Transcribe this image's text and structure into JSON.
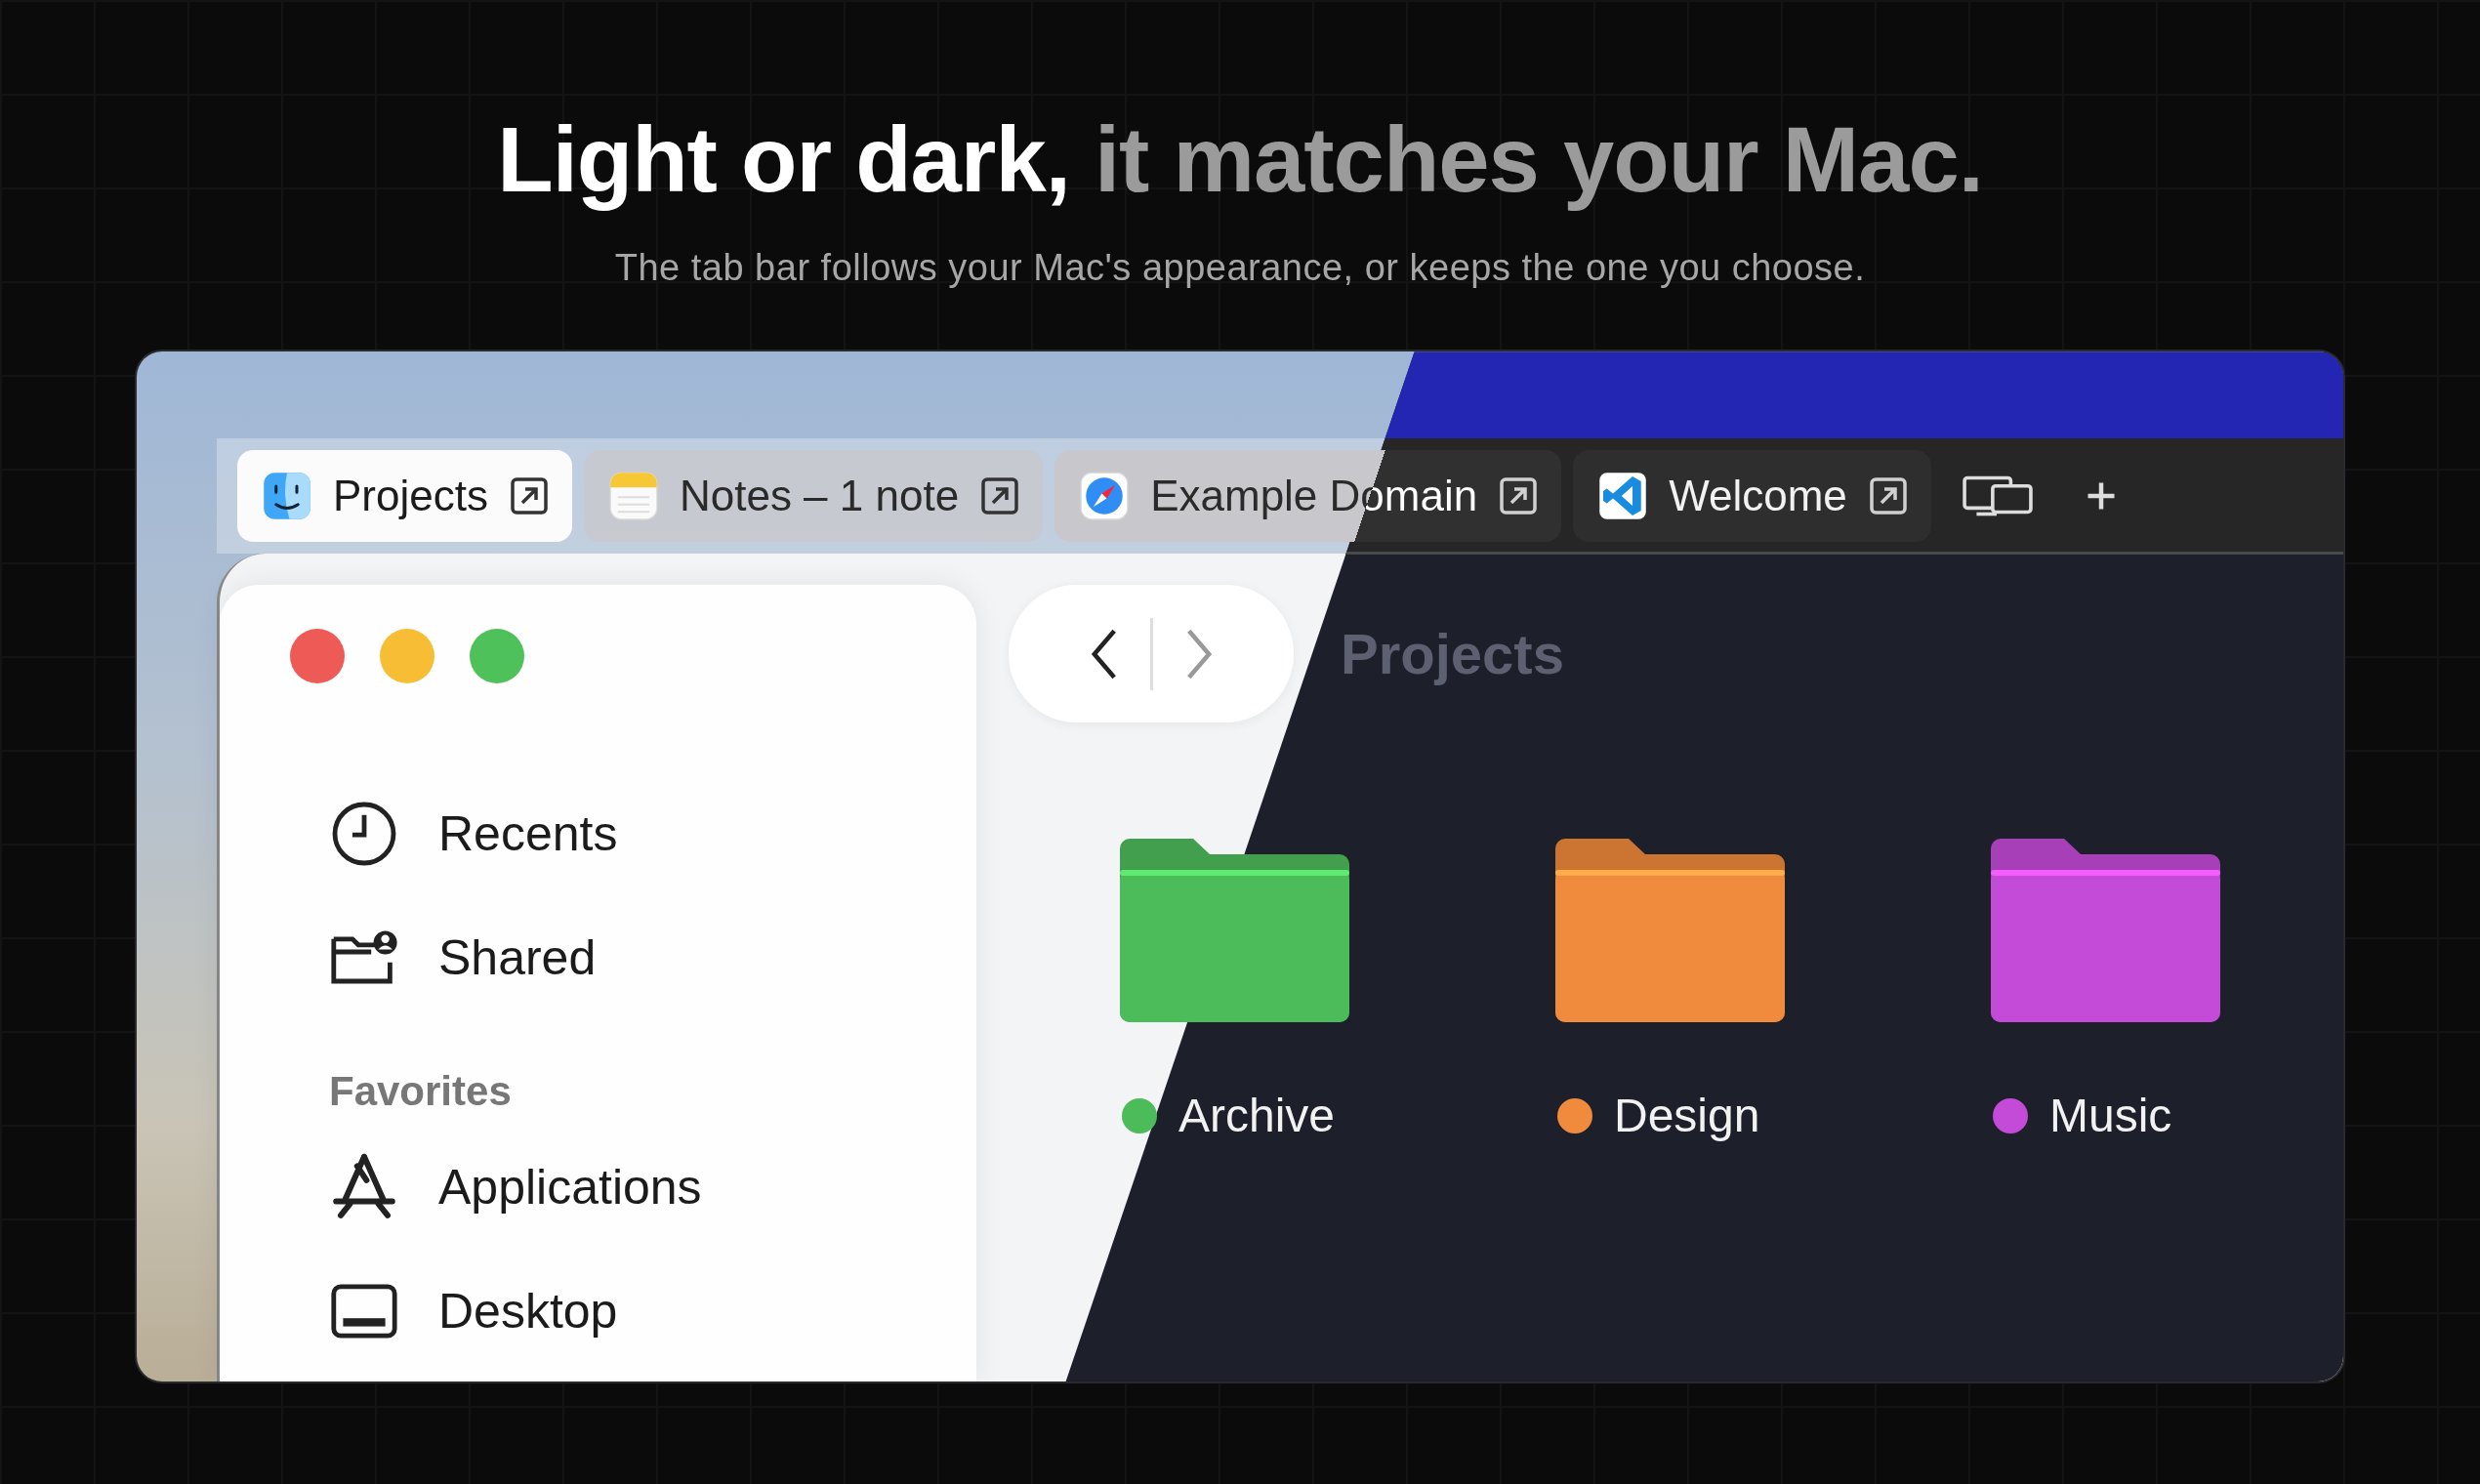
{
  "headline": {
    "text": "Light or dark,",
    "muted": "it matches your Mac."
  },
  "subtitle": "The tab bar follows your Mac's appearance, or keeps the one you choose.",
  "tabs": [
    {
      "label": "Projects",
      "selected": true,
      "kind": "light"
    },
    {
      "label": "Notes – 1 note",
      "selected": false,
      "kind": "light"
    },
    {
      "label": "Example Domain",
      "selected": false,
      "kind": "split"
    },
    {
      "label": "Welcome",
      "selected": false,
      "kind": "dark"
    }
  ],
  "sidebar": {
    "items": [
      {
        "kind": "item",
        "label": "Recents"
      },
      {
        "kind": "item",
        "label": "Shared"
      },
      {
        "kind": "section",
        "label": "Favorites"
      },
      {
        "kind": "item",
        "label": "Applications"
      },
      {
        "kind": "item",
        "label": "Desktop"
      }
    ]
  },
  "folder_title": "Projects",
  "folders": [
    {
      "label": "Archive",
      "color": "#4cbb5a"
    },
    {
      "label": "Design",
      "color": "#f08a3c"
    },
    {
      "label": "Music",
      "color": "#c44ad8"
    }
  ]
}
